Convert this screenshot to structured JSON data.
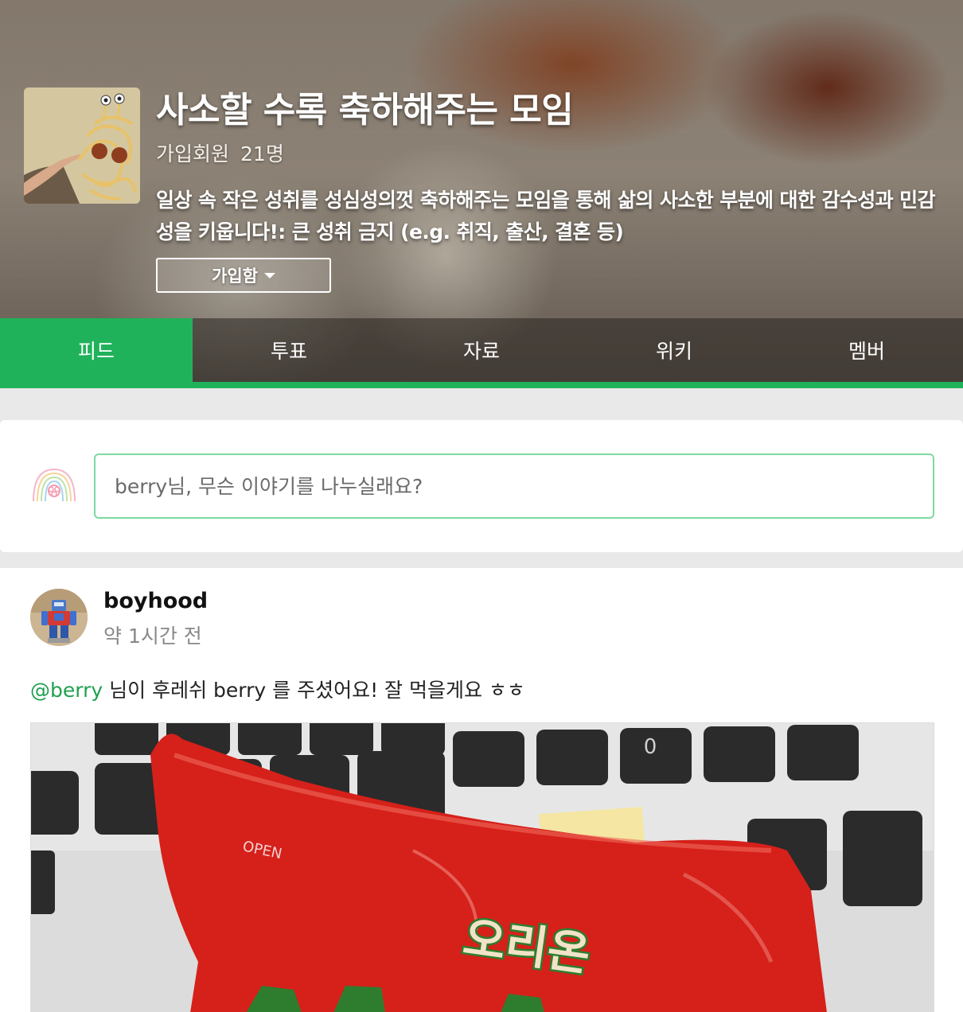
{
  "group": {
    "title": "사소할 수록 축하해주는 모임",
    "member_label": "가입회원",
    "member_count": "21명",
    "description": "일상 속 작은 성취를 성심성의껏 축하해주는 모임을 통해 삶의 사소한 부분에 대한 감수성과 민감성을 키웁니다!: 큰 성취 금지 (e.g. 취직, 출산, 결혼 등)",
    "join_label": "가입함"
  },
  "tabs": [
    {
      "label": "피드",
      "active": true
    },
    {
      "label": "투표",
      "active": false
    },
    {
      "label": "자료",
      "active": false
    },
    {
      "label": "위키",
      "active": false
    },
    {
      "label": "멤버",
      "active": false
    }
  ],
  "composer": {
    "placeholder": "berry님, 무슨 이야기를 나누실래요?"
  },
  "post": {
    "author": "boyhood",
    "time": "약 1시간 전",
    "mention": "@berry",
    "body": " 님이 후레쉬 berry 를 주셨어요! 잘 먹을게요 ㅎㅎ",
    "photo_text": {
      "brand": "오리온",
      "open_label": "OPEN",
      "key_zero": "0"
    }
  },
  "colors": {
    "accent": "#20b25a",
    "input_border": "#7ed9a1",
    "mention": "#20a050"
  }
}
